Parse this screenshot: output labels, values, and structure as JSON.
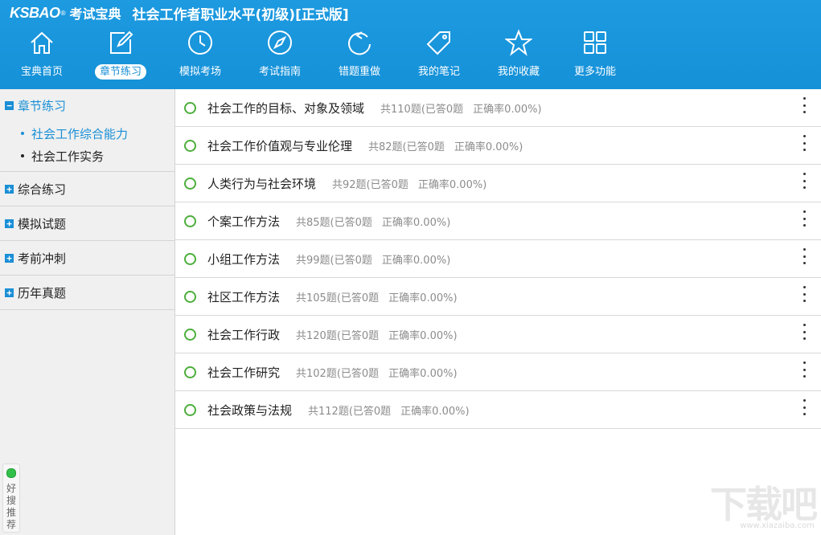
{
  "header": {
    "brand": "KSBAO",
    "brand_sup": "®",
    "brand_cn": "考试宝典",
    "title": "社会工作者职业水平(初级)[正式版]"
  },
  "nav": [
    {
      "label": "宝典首页",
      "icon": "home-icon"
    },
    {
      "label": "章节练习",
      "icon": "edit-icon"
    },
    {
      "label": "模拟考场",
      "icon": "clock-icon"
    },
    {
      "label": "考试指南",
      "icon": "compass-icon"
    },
    {
      "label": "错题重做",
      "icon": "refresh-icon"
    },
    {
      "label": "我的笔记",
      "icon": "tag-icon"
    },
    {
      "label": "我的收藏",
      "icon": "star-icon"
    },
    {
      "label": "更多功能",
      "icon": "grid-icon"
    }
  ],
  "sidebar": {
    "sections": [
      {
        "label": "章节练习",
        "toggle": "−",
        "children": [
          "社会工作综合能力",
          "社会工作实务"
        ]
      },
      {
        "label": "综合练习",
        "toggle": "+"
      },
      {
        "label": "模拟试题",
        "toggle": "+"
      },
      {
        "label": "考前冲刺",
        "toggle": "+"
      },
      {
        "label": "历年真题",
        "toggle": "+"
      }
    ],
    "recommend": "好搜推荐"
  },
  "chapters": [
    {
      "title": "社会工作的目标、对象及领域",
      "stats": "共110题(已答0题",
      "accuracy": "正确率0.00%)"
    },
    {
      "title": "社会工作价值观与专业伦理",
      "stats": "共82题(已答0题",
      "accuracy": "正确率0.00%)"
    },
    {
      "title": "人类行为与社会环境",
      "stats": "共92题(已答0题",
      "accuracy": "正确率0.00%)"
    },
    {
      "title": "个案工作方法",
      "stats": "共85题(已答0题",
      "accuracy": "正确率0.00%)"
    },
    {
      "title": "小组工作方法",
      "stats": "共99题(已答0题",
      "accuracy": "正确率0.00%)"
    },
    {
      "title": "社区工作方法",
      "stats": "共105题(已答0题",
      "accuracy": "正确率0.00%)"
    },
    {
      "title": "社会工作行政",
      "stats": "共120题(已答0题",
      "accuracy": "正确率0.00%)"
    },
    {
      "title": "社会工作研究",
      "stats": "共102题(已答0题",
      "accuracy": "正确率0.00%)"
    },
    {
      "title": "社会政策与法规",
      "stats": "共112题(已答0题",
      "accuracy": "正确率0.00%)"
    }
  ],
  "watermark": {
    "text": "下载吧",
    "sub": "www.xiazaiba.com"
  },
  "colors": {
    "header": "#1591d8",
    "accent": "#1a8fd6",
    "circle": "#4cae3b"
  }
}
